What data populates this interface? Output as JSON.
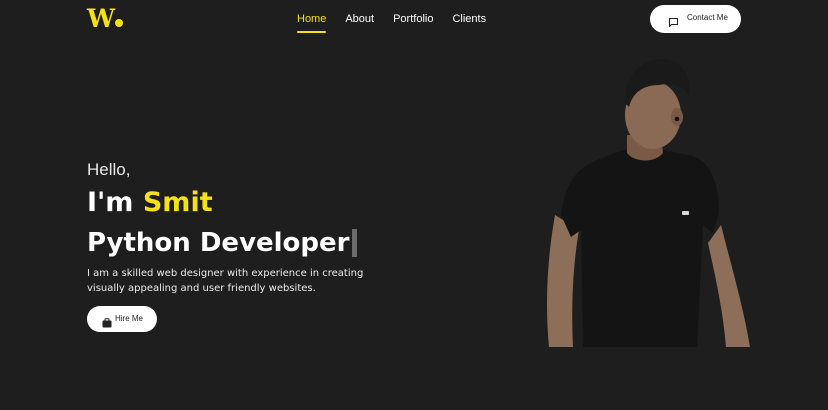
{
  "nav": {
    "logo": "W",
    "items": [
      {
        "label": "Home",
        "active": true
      },
      {
        "label": "About",
        "active": false
      },
      {
        "label": "Portfolio",
        "active": false
      },
      {
        "label": "Clients",
        "active": false
      }
    ],
    "contact_label": "Contact Me",
    "contact_icon": "chat-icon"
  },
  "hero": {
    "greeting": "Hello,",
    "intro_prefix": "I'm",
    "name": "Smit",
    "role": "Python Developer",
    "description_line1": "I am a skilled web designer with experience in creating",
    "description_line2": "visually appealing and user friendly websites.",
    "hire_label": "Hire Me",
    "hire_icon": "briefcase-icon"
  },
  "colors": {
    "background": "#1e1e1e",
    "accent": "#f4e11a",
    "text": "#ffffff",
    "button_bg": "#ffffff"
  }
}
